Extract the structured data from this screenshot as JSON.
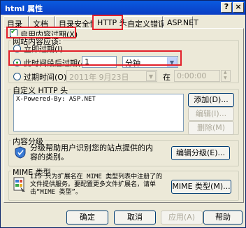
{
  "window": {
    "title": "html 属性",
    "help": "?",
    "close": "×"
  },
  "tabs": [
    "目录",
    "文档",
    "目录安全性",
    "HTTP 头",
    "自定义错误",
    "ASP.NET"
  ],
  "expiration": {
    "enable_label": "启用内容过期(X)",
    "enabled": true,
    "group_label": "网站内容应该:",
    "immediate_label": "立即过期(I)",
    "after_label": "此时间段后过期(A)",
    "after_value": "1",
    "after_unit": "分钟",
    "at_label": "过期时间(O)",
    "at_date": "2011年 9月23日",
    "at_time_label": "在",
    "at_time": "0:00:00"
  },
  "custom_headers": {
    "label": "自定义 HTTP 头",
    "items": [
      "X-Powered-By: ASP.NET"
    ],
    "add": "添加(D)...",
    "edit": "编辑(I)...",
    "remove": "删除(M)"
  },
  "rating": {
    "label": "内容分级",
    "description": "分级帮助用户识别您的站点提供的内容的类别。",
    "button": "编辑分级(E)..."
  },
  "mime": {
    "label": "MIME 类型",
    "description": "IIS 只为扩展名在 MIME 类型列表中注册了的文件提供服务。要配置更多文件扩展名，请单击“MIME 类型”。",
    "button": "MIME 类型(M)..."
  },
  "footer": {
    "ok": "确定",
    "cancel": "取消",
    "apply": "应用(A)",
    "help": "帮助"
  },
  "colors": {
    "highlight": "#e2202a",
    "title_bar": "#0a3ec4",
    "dialog_bg": "#ece9d8"
  }
}
